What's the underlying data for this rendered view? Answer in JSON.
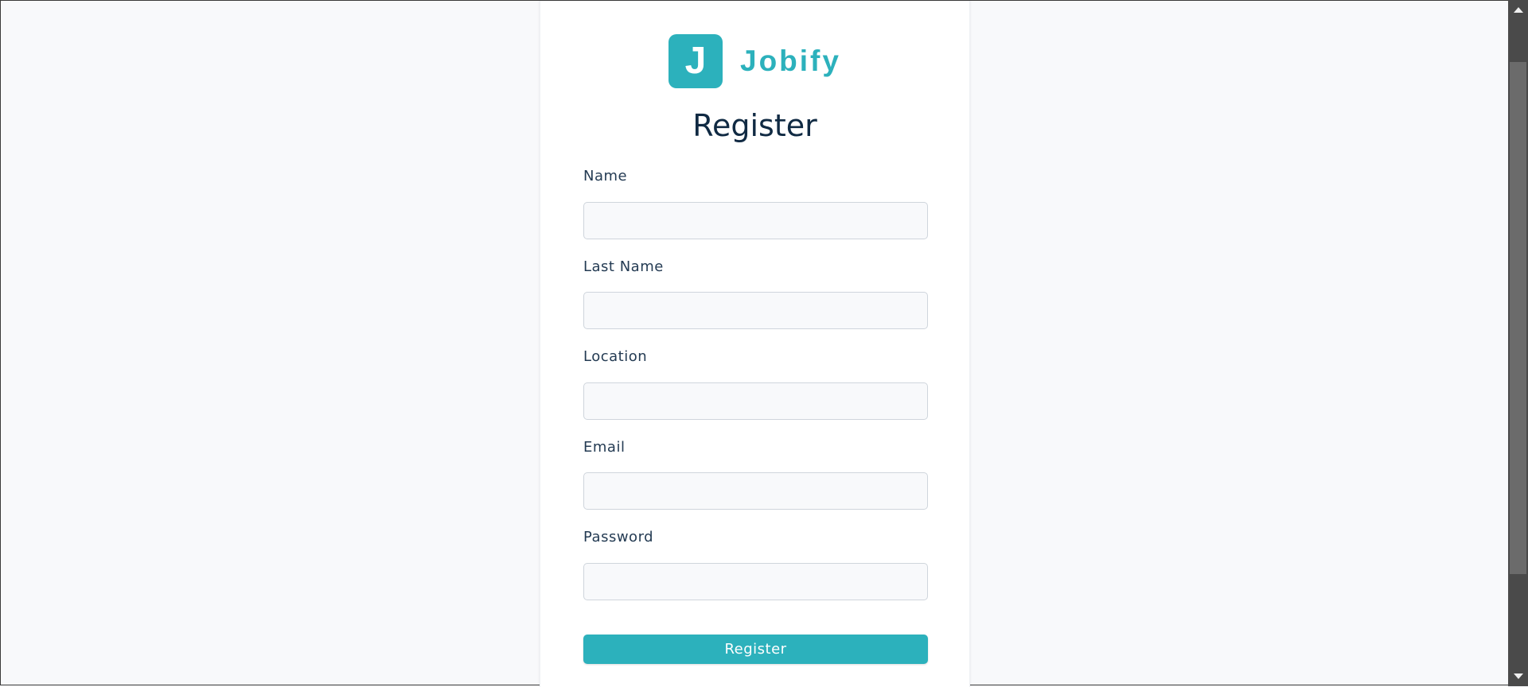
{
  "brand": {
    "logo_letter": "J",
    "name": "Jobify",
    "accent_color": "#2cb1bc"
  },
  "form": {
    "title": "Register",
    "fields": [
      {
        "label": "Name",
        "value": "",
        "placeholder": ""
      },
      {
        "label": "Last Name",
        "value": "",
        "placeholder": ""
      },
      {
        "label": "Location",
        "value": "",
        "placeholder": ""
      },
      {
        "label": "Email",
        "value": "",
        "placeholder": ""
      },
      {
        "label": "Password",
        "value": "",
        "placeholder": ""
      }
    ],
    "submit_label": "Register"
  },
  "scrollbar": {
    "up_icon": "triangle-up-icon",
    "down_icon": "triangle-down-icon"
  }
}
